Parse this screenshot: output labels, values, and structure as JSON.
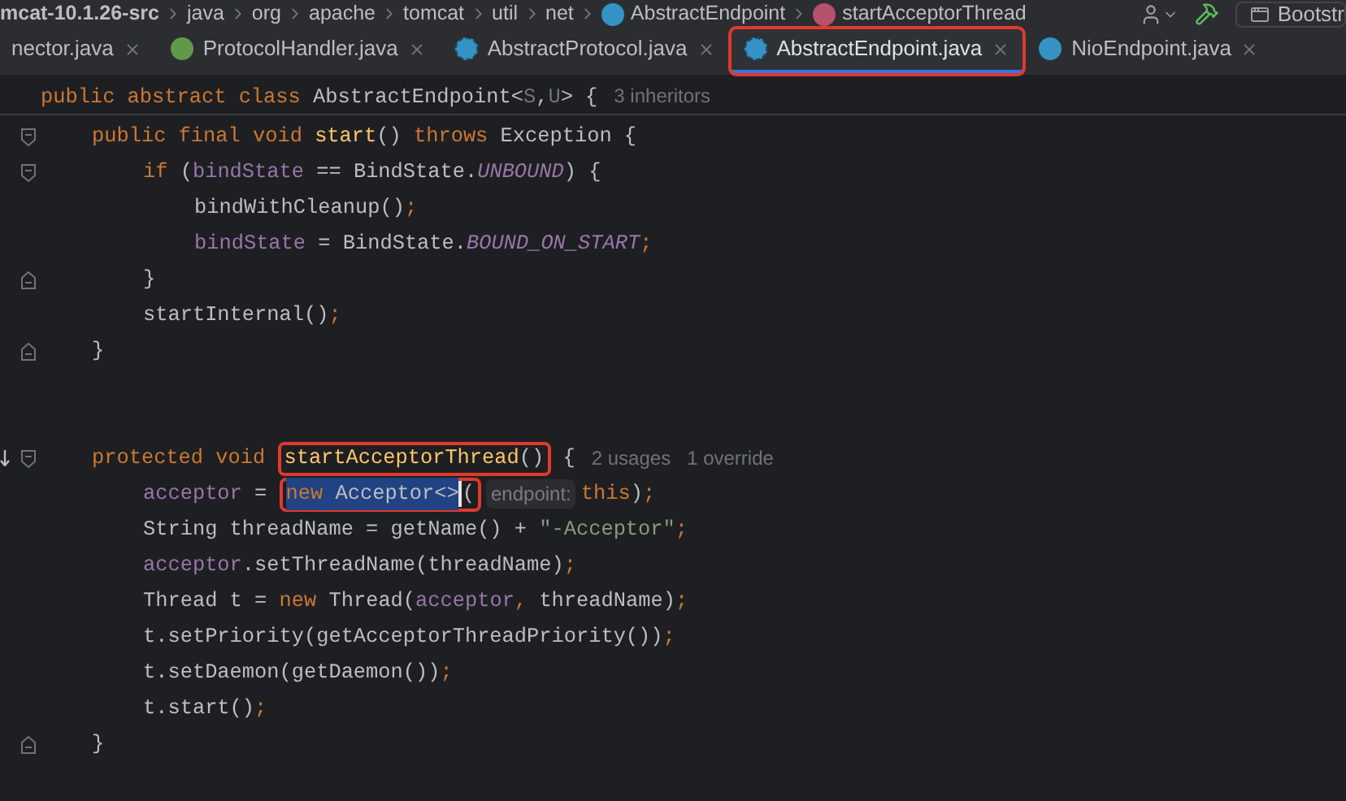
{
  "breadcrumbs": [
    {
      "label": "mcat-10.1.26-src",
      "kind": "project"
    },
    {
      "label": "java",
      "kind": "folder"
    },
    {
      "label": "org",
      "kind": "folder"
    },
    {
      "label": "apache",
      "kind": "folder"
    },
    {
      "label": "tomcat",
      "kind": "folder"
    },
    {
      "label": "util",
      "kind": "folder"
    },
    {
      "label": "net",
      "kind": "folder"
    },
    {
      "label": "AbstractEndpoint",
      "kind": "class"
    },
    {
      "label": "startAcceptorThread",
      "kind": "method"
    }
  ],
  "toolbar": {
    "run_config": "Bootstr"
  },
  "tabs": [
    {
      "label": "nector.java",
      "kind": "file",
      "selected": false,
      "annotated": false
    },
    {
      "label": "ProtocolHandler.java",
      "kind": "interface",
      "selected": false,
      "annotated": false
    },
    {
      "label": "AbstractProtocol.java",
      "kind": "abstract_class",
      "selected": false,
      "annotated": false
    },
    {
      "label": "AbstractEndpoint.java",
      "kind": "abstract_class",
      "selected": true,
      "annotated": true
    },
    {
      "label": "NioEndpoint.java",
      "kind": "class",
      "selected": false,
      "annotated": false
    }
  ],
  "code": {
    "lines": [
      {
        "kind": "code",
        "tokens": [
          {
            "kind": "kw",
            "t": "public abstract class "
          },
          {
            "kind": "plain",
            "t": "AbstractEndpoint<"
          },
          {
            "kind": "tparam",
            "t": "S"
          },
          {
            "kind": "plain",
            "t": ","
          },
          {
            "kind": "tparam",
            "t": "U"
          },
          {
            "kind": "plain",
            "t": "> {"
          }
        ],
        "hints": [
          "3 inheritors"
        ],
        "children": [
          {
            "kind": "block_start",
            "tokens": [
              {
                "kind": "kw",
                "t": "public final void "
              },
              {
                "kind": "decl",
                "t": "start"
              },
              {
                "kind": "plain",
                "t": "() "
              },
              {
                "kind": "kw",
                "t": "throws "
              },
              {
                "kind": "plain",
                "t": "Exception {"
              }
            ],
            "children": [
              {
                "kind": "block_start",
                "tokens": [
                  {
                    "kind": "kw",
                    "t": "if "
                  },
                  {
                    "kind": "plain",
                    "t": "("
                  },
                  {
                    "kind": "field",
                    "t": "bindState"
                  },
                  {
                    "kind": "plain",
                    "t": " == BindState."
                  },
                  {
                    "kind": "const",
                    "t": "UNBOUND"
                  },
                  {
                    "kind": "plain",
                    "t": ") {"
                  }
                ],
                "children": [
                  {
                    "kind": "code",
                    "tokens": [
                      {
                        "kind": "plain",
                        "t": "bindWithCleanup()"
                      },
                      {
                        "kind": "kw",
                        "t": ";"
                      }
                    ]
                  },
                  {
                    "kind": "code",
                    "tokens": [
                      {
                        "kind": "field",
                        "t": "bindState"
                      },
                      {
                        "kind": "plain",
                        "t": " = BindState."
                      },
                      {
                        "kind": "const",
                        "t": "BOUND_ON_START"
                      },
                      {
                        "kind": "kw",
                        "t": ";"
                      }
                    ]
                  }
                ]
              },
              {
                "kind": "block_end",
                "tokens": [
                  {
                    "kind": "plain",
                    "t": "}"
                  }
                ]
              },
              {
                "kind": "code",
                "tokens": [
                  {
                    "kind": "plain",
                    "t": "startInternal()"
                  },
                  {
                    "kind": "kw",
                    "t": ";"
                  }
                ]
              }
            ]
          },
          {
            "kind": "block_end",
            "tokens": [
              {
                "kind": "plain",
                "t": "}"
              }
            ]
          },
          {
            "kind": "blank"
          },
          {
            "kind": "blank"
          },
          {
            "kind": "override_block_start",
            "tokens": [
              {
                "kind": "kw",
                "t": "protected void "
              },
              {
                "kind": "boxed",
                "tokens": [
                  {
                    "kind": "decl",
                    "t": "startAcceptorThread"
                  },
                  {
                    "kind": "plain",
                    "t": "()"
                  }
                ]
              },
              {
                "kind": "plain",
                "t": " {"
              }
            ],
            "hints": [
              "2 usages",
              "1 override"
            ],
            "children": [
              {
                "kind": "code",
                "tokens": [
                  {
                    "kind": "field",
                    "t": "acceptor"
                  },
                  {
                    "kind": "plain",
                    "t": " = "
                  },
                  {
                    "kind": "boxed",
                    "tokens": [
                      {
                        "kind": "selection",
                        "tokens": [
                          {
                            "kind": "kw",
                            "t": "new "
                          },
                          {
                            "kind": "plain",
                            "t": "Acceptor<>"
                          }
                        ]
                      },
                      {
                        "kind": "plain",
                        "t": "("
                      }
                    ]
                  },
                  {
                    "kind": "param_hint",
                    "t": "endpoint:"
                  },
                  {
                    "kind": "kw",
                    "t": "this"
                  },
                  {
                    "kind": "plain",
                    "t": ")"
                  },
                  {
                    "kind": "kw",
                    "t": ";"
                  }
                ]
              },
              {
                "kind": "code",
                "tokens": [
                  {
                    "kind": "plain",
                    "t": "String threadName = getName() + "
                  },
                  {
                    "kind": "string",
                    "t": "\"-Acceptor\""
                  },
                  {
                    "kind": "kw",
                    "t": ";"
                  }
                ]
              },
              {
                "kind": "code",
                "tokens": [
                  {
                    "kind": "field",
                    "t": "acceptor"
                  },
                  {
                    "kind": "plain",
                    "t": ".setThreadName(threadName)"
                  },
                  {
                    "kind": "kw",
                    "t": ";"
                  }
                ]
              },
              {
                "kind": "code",
                "tokens": [
                  {
                    "kind": "plain",
                    "t": "Thread t = "
                  },
                  {
                    "kind": "kw",
                    "t": "new "
                  },
                  {
                    "kind": "plain",
                    "t": "Thread("
                  },
                  {
                    "kind": "field",
                    "t": "acceptor"
                  },
                  {
                    "kind": "kw",
                    "t": ", "
                  },
                  {
                    "kind": "plain",
                    "t": "threadName)"
                  },
                  {
                    "kind": "kw",
                    "t": ";"
                  }
                ]
              },
              {
                "kind": "code",
                "tokens": [
                  {
                    "kind": "plain",
                    "t": "t.setPriority(getAcceptorThreadPriority())"
                  },
                  {
                    "kind": "kw",
                    "t": ";"
                  }
                ]
              },
              {
                "kind": "code",
                "tokens": [
                  {
                    "kind": "plain",
                    "t": "t.setDaemon(getDaemon())"
                  },
                  {
                    "kind": "kw",
                    "t": ";"
                  }
                ]
              },
              {
                "kind": "code",
                "tokens": [
                  {
                    "kind": "plain",
                    "t": "t.start()"
                  },
                  {
                    "kind": "kw",
                    "t": ";"
                  }
                ]
              }
            ]
          },
          {
            "kind": "block_end",
            "tokens": [
              {
                "kind": "plain",
                "t": "}"
              }
            ]
          }
        ]
      }
    ]
  }
}
